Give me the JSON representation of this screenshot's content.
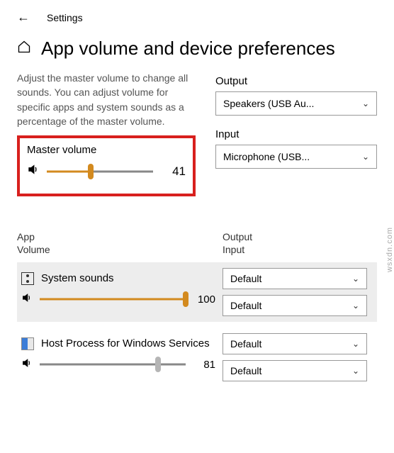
{
  "topbar": {
    "settings": "Settings"
  },
  "page": {
    "title": "App volume and device preferences"
  },
  "description": "Adjust the master volume to change all sounds. You can adjust volume for specific apps and system sounds as a percentage of the master volume.",
  "master": {
    "label": "Master volume",
    "value": "41",
    "pct": 41
  },
  "output": {
    "label": "Output",
    "value": "Speakers (USB Au..."
  },
  "input": {
    "label": "Input",
    "value": "Microphone (USB..."
  },
  "cols": {
    "left1": "App",
    "left2": "Volume",
    "right1": "Output",
    "right2": "Input"
  },
  "apps": [
    {
      "name": "System sounds",
      "value": "100",
      "pct": 100,
      "out": "Default",
      "in": "Default",
      "icon": "sys",
      "shaded": true
    },
    {
      "name": "Host Process for Windows Services",
      "value": "81",
      "pct": 81,
      "out": "Default",
      "in": "Default",
      "icon": "host",
      "shaded": false,
      "gray": true
    }
  ],
  "watermark": "wsxdn.com"
}
